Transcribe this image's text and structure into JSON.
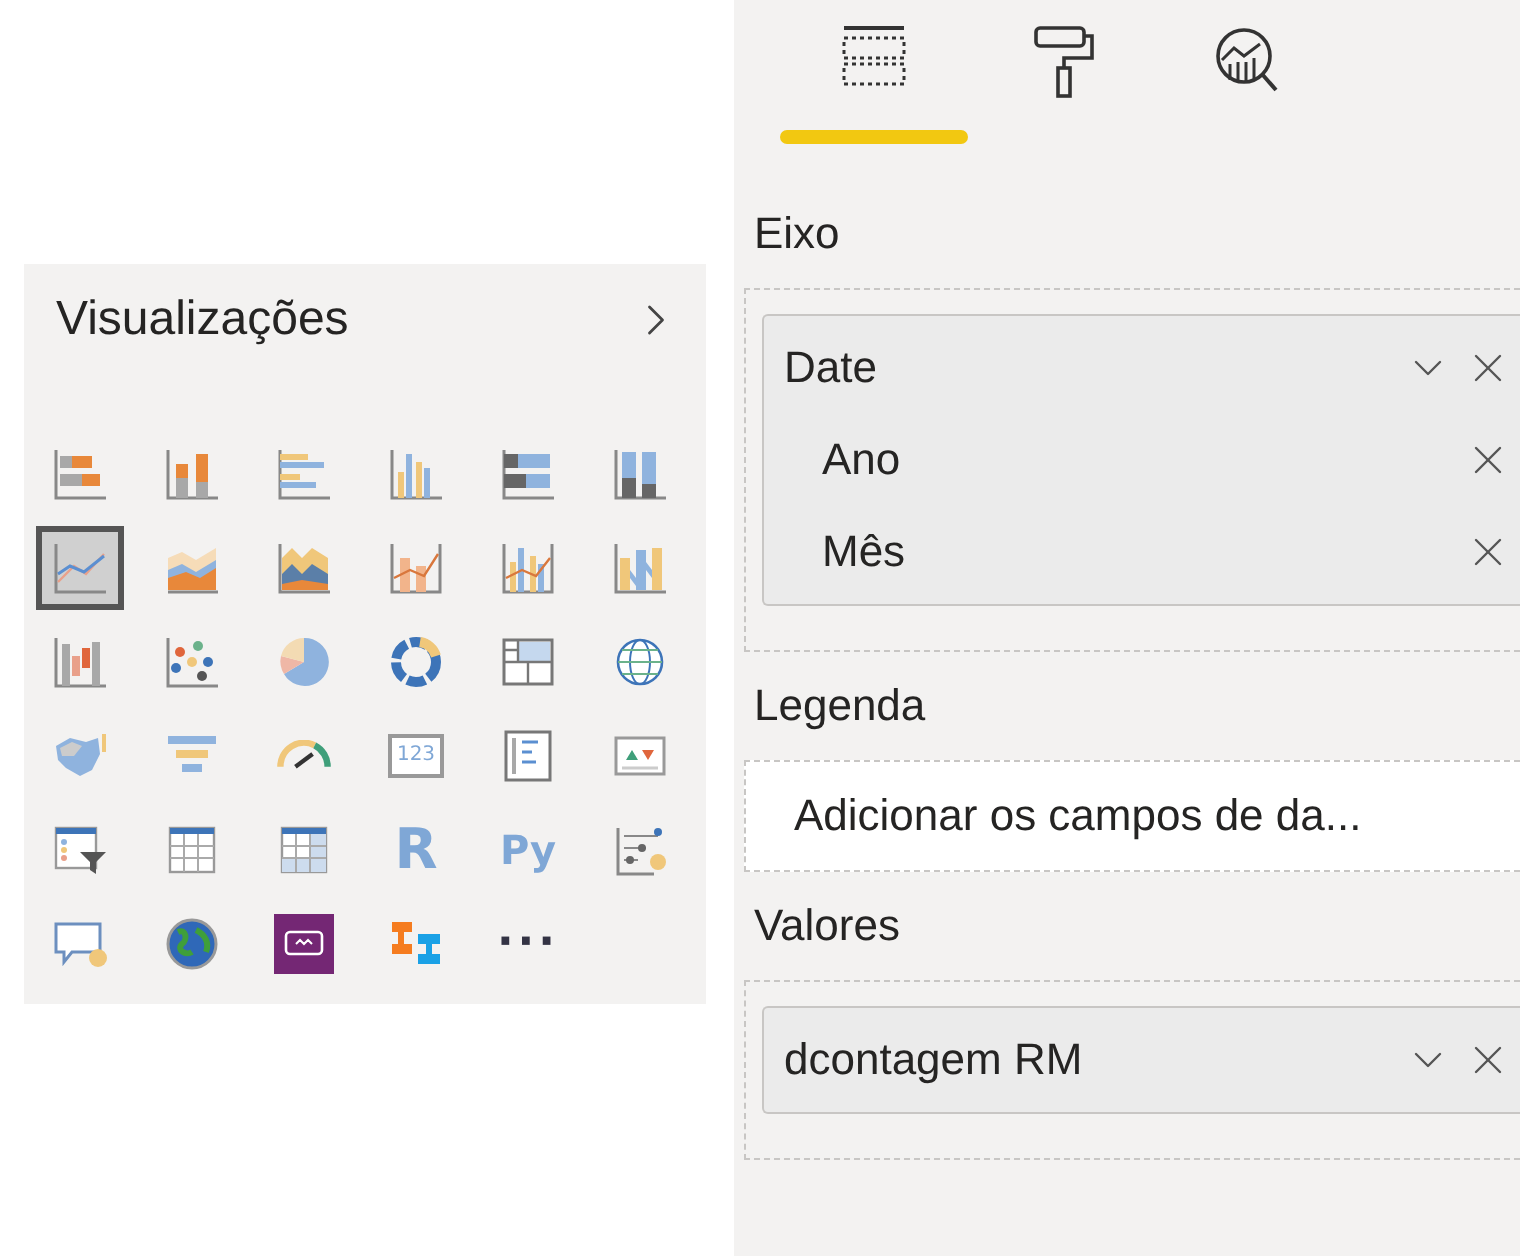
{
  "visualizations": {
    "title": "Visualizações",
    "items": [
      {
        "kind": "icon",
        "selected": false
      },
      {
        "kind": "icon",
        "selected": false
      },
      {
        "kind": "icon",
        "selected": false
      },
      {
        "kind": "icon",
        "selected": false
      },
      {
        "kind": "icon",
        "selected": false
      },
      {
        "kind": "icon",
        "selected": false
      },
      {
        "kind": "icon",
        "selected": true
      },
      {
        "kind": "icon",
        "selected": false
      },
      {
        "kind": "icon",
        "selected": false
      },
      {
        "kind": "icon",
        "selected": false
      },
      {
        "kind": "icon",
        "selected": false
      },
      {
        "kind": "icon",
        "selected": false
      },
      {
        "kind": "icon",
        "selected": false
      },
      {
        "kind": "icon",
        "selected": false
      },
      {
        "kind": "icon",
        "selected": false
      },
      {
        "kind": "icon",
        "selected": false
      },
      {
        "kind": "icon",
        "selected": false
      },
      {
        "kind": "icon",
        "selected": false
      },
      {
        "kind": "icon",
        "selected": false
      },
      {
        "kind": "icon",
        "selected": false
      },
      {
        "kind": "icon",
        "selected": false
      },
      {
        "kind": "card",
        "label": "123",
        "selected": false
      },
      {
        "kind": "icon",
        "selected": false
      },
      {
        "kind": "icon",
        "selected": false
      },
      {
        "kind": "icon",
        "selected": false
      },
      {
        "kind": "icon",
        "selected": false
      },
      {
        "kind": "icon",
        "selected": false
      },
      {
        "kind": "text",
        "label": "R",
        "selected": false
      },
      {
        "kind": "text",
        "label": "Py",
        "selected": false
      },
      {
        "kind": "icon",
        "selected": false
      },
      {
        "kind": "icon",
        "selected": false
      },
      {
        "kind": "icon",
        "selected": false
      },
      {
        "kind": "icon",
        "selected": false
      },
      {
        "kind": "icon",
        "selected": false
      },
      {
        "kind": "text",
        "label": "···",
        "selected": false
      }
    ]
  },
  "fields_pane": {
    "tabs": [
      {
        "selected": true
      },
      {
        "selected": false
      },
      {
        "selected": false
      }
    ],
    "wells": [
      {
        "label": "Eixo",
        "fields": [
          {
            "name": "Date",
            "children": [
              {
                "name": "Ano"
              },
              {
                "name": "Mês"
              }
            ]
          }
        ]
      },
      {
        "label": "Legenda",
        "placeholder": "Adicionar os campos de da..."
      },
      {
        "label": "Valores",
        "fields": [
          {
            "name": "dcontagem RM"
          }
        ]
      }
    ]
  }
}
